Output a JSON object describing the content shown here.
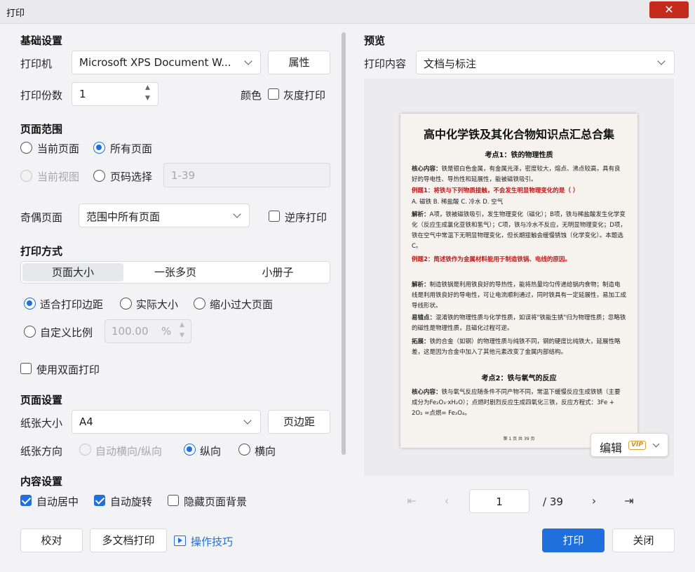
{
  "window": {
    "title": "打印",
    "close_glyph": "✕"
  },
  "basic": {
    "section": "基础设置",
    "printer_label": "打印机",
    "printer_value": "Microsoft XPS Document W...",
    "properties_button": "属性",
    "copies_label": "打印份数",
    "copies_value": "1",
    "color_label": "颜色",
    "grayscale_label": "灰度打印",
    "grayscale_checked": false
  },
  "range": {
    "section": "页面范围",
    "current_page": "当前页面",
    "all_pages": "所有页面",
    "current_view": "当前视图",
    "page_select": "页码选择",
    "page_select_placeholder": "1-39",
    "selected": "all_pages"
  },
  "odd_even": {
    "label": "奇偶页面",
    "value": "范围中所有页面",
    "reverse_label": "逆序打印",
    "reverse_checked": false
  },
  "print_mode": {
    "section": "打印方式",
    "tabs": [
      "页面大小",
      "一张多页",
      "小册子"
    ],
    "selected_tab": 0,
    "fit_margins": "适合打印边距",
    "actual_size": "实际大小",
    "shrink_large": "缩小过大页面",
    "custom_scale": "自定义比例",
    "scale_value": "100.00",
    "scale_unit": "%",
    "duplex_label": "使用双面打印",
    "duplex_checked": false,
    "selected_scaling": "fit_margins"
  },
  "page_setup": {
    "section": "页面设置",
    "paper_size_label": "纸张大小",
    "paper_size_value": "A4",
    "margins_button": "页边距",
    "orientation_label": "纸张方向",
    "auto_orientation": "自动横向/纵向",
    "portrait": "纵向",
    "landscape": "横向",
    "selected_orientation": "portrait"
  },
  "content": {
    "section": "内容设置",
    "auto_center": "自动居中",
    "auto_center_checked": true,
    "auto_rotate": "自动旋转",
    "auto_rotate_checked": true,
    "hide_background": "隐藏页面背景",
    "hide_background_checked": false
  },
  "footer": {
    "proofread_button": "校对",
    "multi_doc_button": "多文档打印",
    "tips_link": "操作技巧",
    "print_button": "打印",
    "close_button": "关闭"
  },
  "preview": {
    "section": "预览",
    "content_label": "打印内容",
    "content_value": "文档与标注",
    "edit_button": "编辑",
    "vip_badge": "VIP",
    "current_page": "1",
    "page_total": "/ 39",
    "doc": {
      "title": "高中化学铁及其化合物知识点汇总合集",
      "heading1": "考点1：铁的物理性质",
      "p1_label": "核心内容：",
      "p1_text": "铁是银白色金属，有金属光泽，密度较大，熔点、沸点较高，具有良好的导电性、导热性和延展性，能被磁铁吸引。",
      "ex1": "例题1：将铁与下列物质接触，不会发生明显物理变化的是（ ）",
      "ex1_options": "A. 磁铁      B. 稀盐酸      C. 冷水      D. 空气",
      "ana1_label": "解析：",
      "ana1_text": "A项，铁被磁铁吸引，发生物理变化（磁化）；B项，铁与稀盐酸发生化学变化（反应生成氯化亚铁和氢气）；C项，铁与冷水不反应，无明显物理变化；D项，铁在空气中常温下无明显物理变化，但长期接触会缓慢锈蚀（化学变化）。本题选C。",
      "ex2": "例题2：简述铁作为金属材料能用于制造铁锅、电线的原因。",
      "ana2_label": "解析：",
      "ana2_text": "制造铁锅是利用铁良好的导热性，能将热量均匀传递给锅内食物；制造电线是利用铁良好的导电性，可让电流顺利通过，同时铁具有一定延展性，易加工成导线形状。",
      "mist_label": "易错点：",
      "mist_text": "混淆铁的物理性质与化学性质，如误将\"铁能生锈\"归为物理性质；忽略铁的磁性是物理性质，且磁化过程可逆。",
      "ext_label": "拓展：",
      "ext_text": "铁的合金（如钢）的物理性质与纯铁不同，钢的硬度比纯铁大，延展性略差，这是因为合金中加入了其他元素改变了金属内部结构。",
      "heading2": "考点2：铁与氧气的反应",
      "p2_label": "核心内容：",
      "p2_text": "铁与氧气反应随条件不同产物不同，常温下缓慢反应生成铁锈（主要成分为Fe₂O₃·xH₂O）；点燃时剧烈反应生成四氧化三铁，反应方程式：3Fe + 2O₂ =点燃= Fe₃O₄。",
      "footer": "第 1 页 共 39 页"
    }
  }
}
